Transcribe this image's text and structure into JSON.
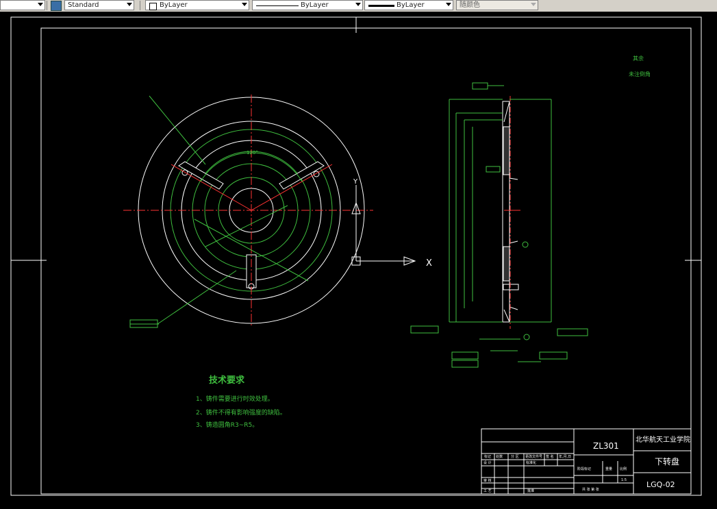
{
  "toolbar": {
    "textstyle": "Standard",
    "layer": "ByLayer",
    "linetype": "ByLayer",
    "lineweight": "ByLayer",
    "plotstyle": "随颜色"
  },
  "drawing": {
    "roughness_note_line1": "其余",
    "roughness_note_line2": "未注倒角",
    "tech_title": "技术要求",
    "tech_items": [
      "1、铸件需要进行时效处理。",
      "2、铸件不得有影响强度的缺陷。",
      "3、铸造圆角R3~R5。"
    ],
    "angle_label": "120°",
    "ucs_y": "Y",
    "ucs_x": "X",
    "material": "ZL301",
    "school": "北华航天工业学院",
    "part_name": "下转盘",
    "drawing_no": "LGQ-02",
    "scale": "1:5",
    "tb_row1": [
      "标记",
      "处数",
      "分 区",
      "更改文件号",
      "签 名",
      "年,月,日"
    ],
    "tb_design": "设 计",
    "tb_review": "审 核",
    "tb_process": "工 艺",
    "tb_approve": "批准",
    "tb_std": "标准化",
    "tb_stage": "阶段标记",
    "tb_weight": "重量",
    "tb_ratio": "比例",
    "tb_sheet": "共   张  第  张"
  }
}
